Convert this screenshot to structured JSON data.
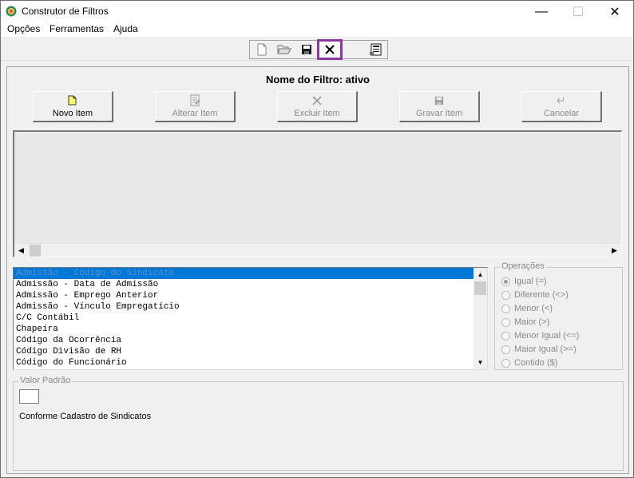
{
  "window": {
    "title": "Construtor de Filtros",
    "controls": {
      "minimize": "—",
      "maximize": "☐",
      "close": "✕"
    }
  },
  "menu": {
    "items": [
      {
        "label": "Opções"
      },
      {
        "label": "Ferramentas"
      },
      {
        "label": "Ajuda"
      }
    ]
  },
  "toolbar": {
    "icons": [
      "new-icon",
      "open-folder-icon",
      "save-icon",
      "close-x-icon",
      "properties-icon"
    ]
  },
  "filter": {
    "title": "Nome do Filtro: ativo"
  },
  "actions": {
    "new": "Novo Item",
    "edit": "Alterar Item",
    "delete": "Excluir Item",
    "save": "Gravar Item",
    "cancel": "Cancelar"
  },
  "fields": {
    "items": [
      "Admissão - Código do Sindicato",
      "Admissão - Data de Admissão",
      "Admissão - Emprego Anterior",
      "Admissão - Vínculo Empregatício",
      "C/C Contábil",
      "Chapeira",
      "Código da Ocorrência",
      "Código Divisão de RH",
      "Código do Funcionário"
    ],
    "selected_index": 0
  },
  "operations": {
    "legend": "Operações",
    "options": [
      "Igual (=)",
      "Diferente (<>)",
      "Menor (<)",
      "Maior  (>)",
      "Menor Igual (<=)",
      "Maior Igual (>=)",
      "Contido ($)"
    ],
    "selected_index": 0
  },
  "default_value": {
    "legend": "Valor Padrão",
    "text": "Conforme Cadastro de Sindicatos"
  },
  "colors": {
    "selection": "#0078d7",
    "toolbar_highlight": "#8b3a9e"
  }
}
